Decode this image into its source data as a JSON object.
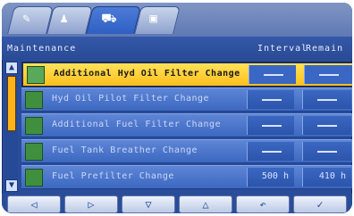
{
  "tabs": [
    {
      "icon": "wrench-icon"
    },
    {
      "icon": "person-icon"
    },
    {
      "icon": "truck-icon"
    },
    {
      "icon": "document-icon"
    }
  ],
  "header": {
    "title": "Maintenance",
    "interval": "Interval",
    "remain": "Remain"
  },
  "items": [
    {
      "label": "Additional Hyd Oil Filter Change",
      "interval": "—",
      "remain": "—",
      "selected": true
    },
    {
      "label": "Hyd Oil Pilot Filter Change",
      "interval": "—",
      "remain": "—",
      "selected": false
    },
    {
      "label": "Additional Fuel Filter Change",
      "interval": "—",
      "remain": "—",
      "selected": false
    },
    {
      "label": "Fuel Tank Breather Change",
      "interval": "—",
      "remain": "—",
      "selected": false
    },
    {
      "label": "Fuel Prefilter Change",
      "interval": "500 h",
      "remain": "410 h",
      "selected": false
    }
  ],
  "bottom_buttons": [
    {
      "label": "◁",
      "name": "left-arrow-button"
    },
    {
      "label": "▷",
      "name": "right-arrow-button"
    },
    {
      "label": "▽",
      "name": "down-arrow-button"
    },
    {
      "label": "△",
      "name": "up-arrow-button"
    },
    {
      "label": "↶",
      "name": "back-button"
    },
    {
      "label": "✓",
      "name": "confirm-button"
    }
  ],
  "colors": {
    "screen_bg": "#2a4d9a",
    "row_bg": "#4c76cf",
    "selected_bg": "#ffd23a",
    "accent": "#ffb21c"
  }
}
